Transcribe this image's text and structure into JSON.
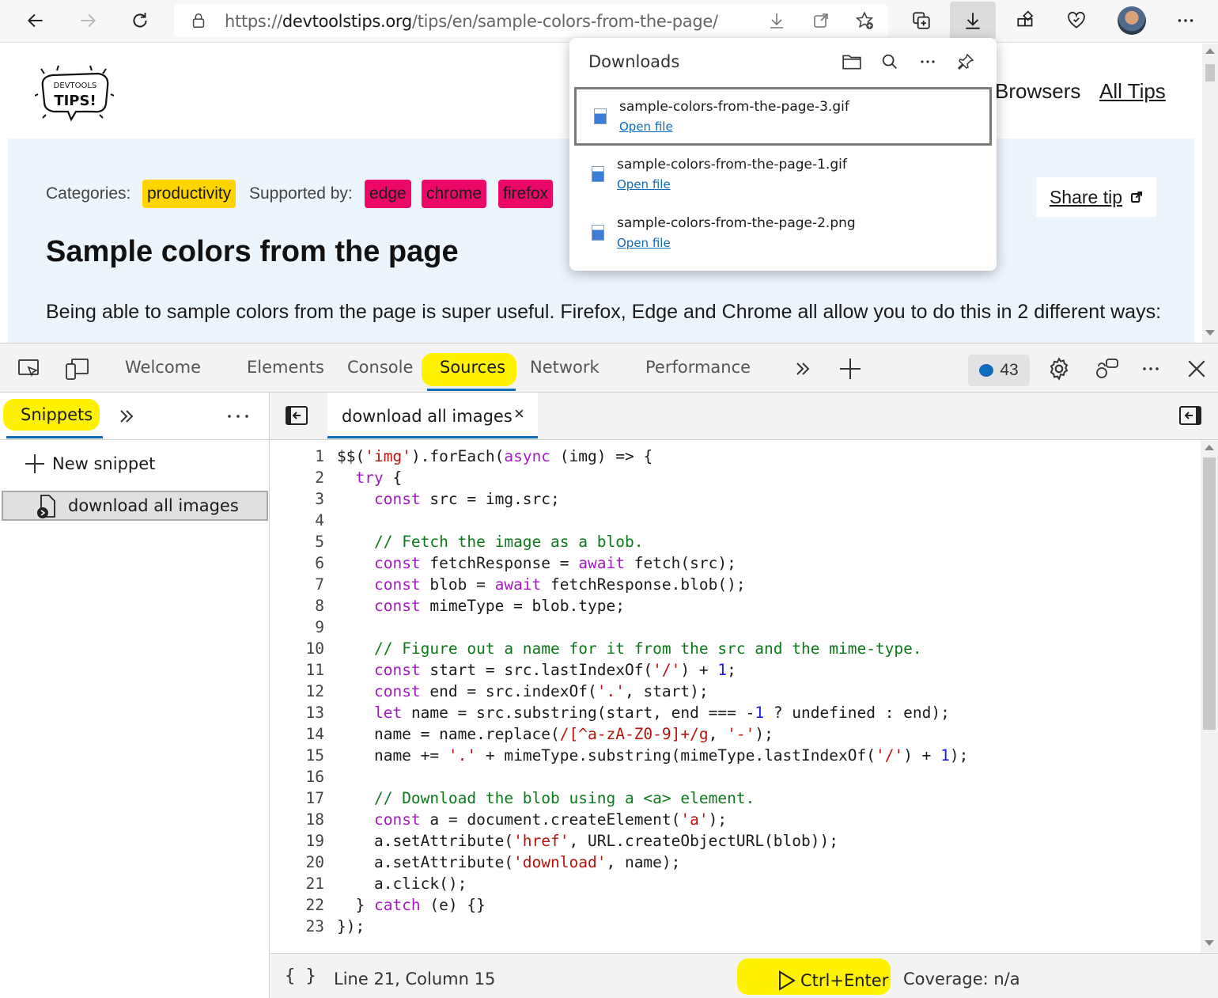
{
  "browser": {
    "url_prefix": "https://",
    "url_host": "devtoolstips.org",
    "url_path": "/tips/en/sample-colors-from-the-page/"
  },
  "page": {
    "logo_text_top": "DEVTOOLS",
    "logo_text_main": "TIPS!",
    "nav": {
      "browsers": "Browsers",
      "all_tips": "All Tips"
    },
    "categories_label": "Categories:",
    "category_tag": "productivity",
    "supported_label": "Supported by:",
    "browser_tags": [
      "edge",
      "chrome",
      "firefox"
    ],
    "share_tip": "Share tip",
    "title": "Sample colors from the page",
    "intro": "Being able to sample colors from the page is super useful. Firefox, Edge and Chrome all allow you to do this in 2 different ways:"
  },
  "downloads": {
    "title": "Downloads",
    "items": [
      {
        "name": "sample-colors-from-the-page-3.gif",
        "action": "Open file"
      },
      {
        "name": "sample-colors-from-the-page-1.gif",
        "action": "Open file"
      },
      {
        "name": "sample-colors-from-the-page-2.png",
        "action": "Open file"
      }
    ]
  },
  "devtools": {
    "tabs": [
      "Welcome",
      "Elements",
      "Console",
      "Sources",
      "Network",
      "Performance"
    ],
    "active_tab": "Sources",
    "issues_count": "43",
    "navigator": {
      "tab": "Snippets",
      "new_snippet": "New snippet",
      "snippet": "download all images"
    },
    "editor": {
      "file_tab": "download all images",
      "close_glyph": "×"
    },
    "status": {
      "braces": "{ }",
      "position": "Line 21, Column 15",
      "run": "Ctrl+Enter",
      "coverage": "Coverage: n/a"
    },
    "code_lines": [
      "1",
      "2",
      "3",
      "4",
      "5",
      "6",
      "7",
      "8",
      "9",
      "10",
      "11",
      "12",
      "13",
      "14",
      "15",
      "16",
      "17",
      "18",
      "19",
      "20",
      "21",
      "22",
      "23"
    ]
  },
  "colors": {
    "highlight": "#fff200",
    "accent": "#0f6cbd",
    "tag_productivity": "#ffd500",
    "tag_browser": "#ec0868",
    "hero_bg": "#edf5fc"
  }
}
